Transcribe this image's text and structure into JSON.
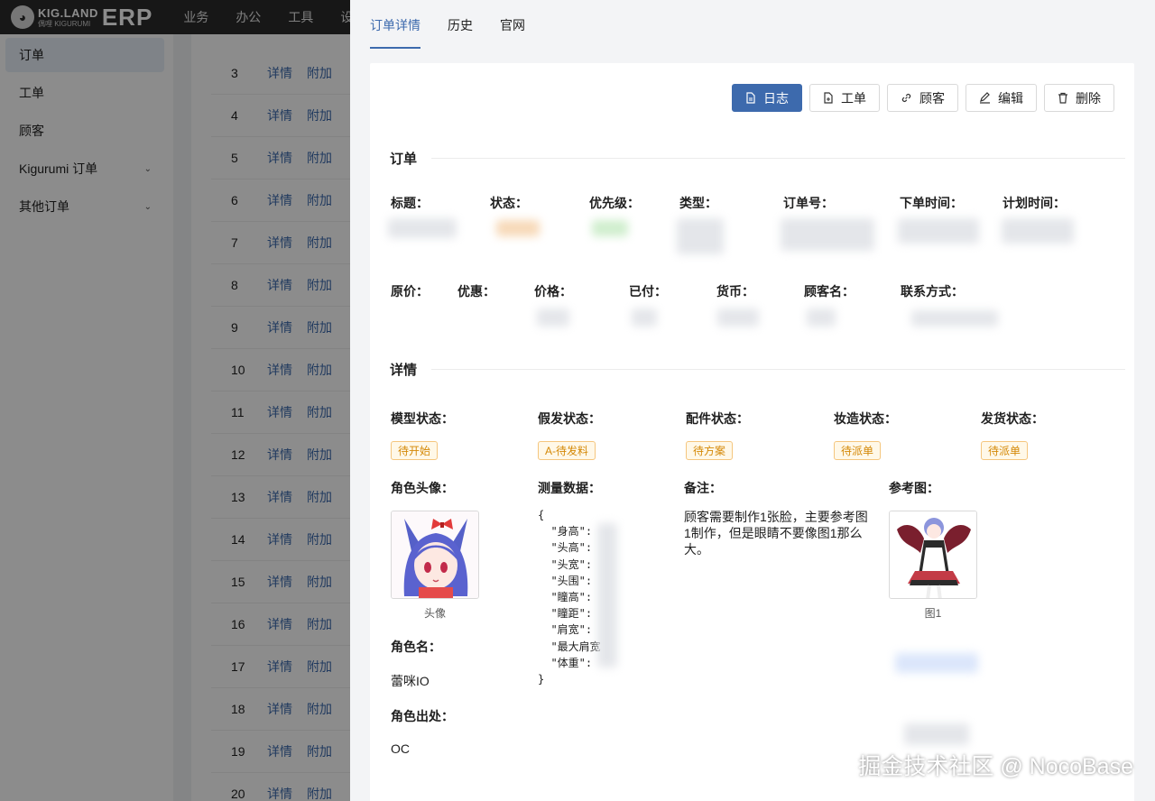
{
  "app": {
    "logo_top": "KIG.LAND",
    "logo_bottom": "偶哩 KIGURUMI",
    "logo_erp": "ERP"
  },
  "topnav": [
    "业务",
    "办公",
    "工具",
    "设"
  ],
  "sidebar": [
    {
      "label": "订单",
      "active": true
    },
    {
      "label": "工单"
    },
    {
      "label": "顾客"
    },
    {
      "label": "Kigurumi 订单",
      "expandable": true
    },
    {
      "label": "其他订单",
      "expandable": true
    }
  ],
  "table": {
    "link_detail": "详情",
    "link_extra": "附加",
    "rows": [
      "3",
      "4",
      "5",
      "6",
      "7",
      "8",
      "9",
      "10",
      "11",
      "12",
      "13",
      "14",
      "15",
      "16",
      "17",
      "18",
      "19",
      "20"
    ]
  },
  "tabs": [
    "订单详情",
    "历史",
    "官网"
  ],
  "actions": {
    "log": "日志",
    "workorder": "工单",
    "customer": "顾客",
    "edit": "编辑",
    "delete": "删除"
  },
  "order_section": {
    "title": "订单",
    "row1": [
      "标题：",
      "状态：",
      "优先级：",
      "类型：",
      "订单号：",
      "下单时间：",
      "计划时间："
    ],
    "row2": [
      "原价：",
      "优惠：",
      "价格：",
      "已付：",
      "货币：",
      "顾客名：",
      "联系方式："
    ]
  },
  "detail_section": {
    "title": "详情",
    "status_fields": [
      {
        "label": "模型状态：",
        "tag": "待开始"
      },
      {
        "label": "假发状态：",
        "tag": "A-待发料"
      },
      {
        "label": "配件状态：",
        "tag": "待方案"
      },
      {
        "label": "妆造状态：",
        "tag": "待派单"
      },
      {
        "label": "发货状态：",
        "tag": "待派单"
      }
    ],
    "avatar_label": "角色头像：",
    "avatar_caption": "头像",
    "measure_label": "测量数据：",
    "measure_lines": [
      "{",
      "  \"身高\":",
      "  \"头高\":",
      "  \"头宽\":",
      "  \"头围\":",
      "  \"瞳高\":",
      "  \"瞳距\":",
      "  \"肩宽\":",
      "  \"最大肩宽",
      "  \"体重\":",
      "}"
    ],
    "remark_label": "备注：",
    "remark_text": "顾客需要制作1张脸，主要参考图1制作，但是眼睛不要像图1那么大。",
    "reference_label": "参考图：",
    "reference_caption": "图1",
    "role_name_label": "角色名：",
    "role_name": "蕾咪IO",
    "role_origin_label": "角色出处：",
    "role_origin": "OC"
  },
  "watermark": "掘金技术社区 @ NocoBase",
  "colors": {
    "primary": "#3d6aad",
    "tag_text": "#d48806",
    "tag_border": "#f5c67e",
    "tag_bg": "#fff8e8",
    "topbar": "#2b2b2b"
  }
}
